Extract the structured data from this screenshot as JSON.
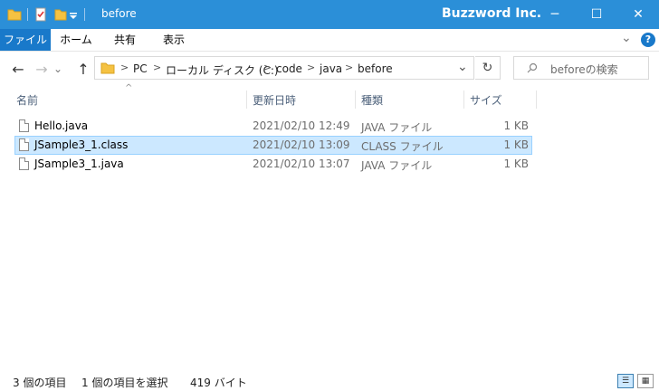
{
  "window": {
    "title": "before",
    "brand": "Buzzword Inc.",
    "controls": {
      "minimize": "─",
      "maximize": "☐",
      "close": "✕"
    }
  },
  "ribbon": {
    "tabs": [
      "ファイル",
      "ホーム",
      "共有",
      "表示"
    ],
    "expand_icon": "⌄",
    "help_icon": "?"
  },
  "nav": {
    "back": "←",
    "forward": "→",
    "recent": "⌄",
    "up": "↑",
    "breadcrumb": [
      "PC",
      "ローカル ディスク (C:)",
      "code",
      "java",
      "before"
    ],
    "refresh": "↻",
    "dropdown": "⌄",
    "search_placeholder": "beforeの検索"
  },
  "columns": [
    "名前",
    "更新日時",
    "種類",
    "サイズ"
  ],
  "files": [
    {
      "name": "Hello.java",
      "modified": "2021/02/10 12:49",
      "type": "JAVA ファイル",
      "size": "1 KB",
      "selected": false
    },
    {
      "name": "JSample3_1.class",
      "modified": "2021/02/10 13:09",
      "type": "CLASS ファイル",
      "size": "1 KB",
      "selected": true
    },
    {
      "name": "JSample3_1.java",
      "modified": "2021/02/10 13:07",
      "type": "JAVA ファイル",
      "size": "1 KB",
      "selected": false
    }
  ],
  "status": {
    "count": "3 個の項目",
    "selection": "1 個の項目を選択",
    "size": "419 バイト"
  },
  "colors": {
    "titlebar": "#2b8fd8",
    "file_tab": "#1979ca",
    "selection": "#cce8ff",
    "folder": "#f5c242"
  }
}
